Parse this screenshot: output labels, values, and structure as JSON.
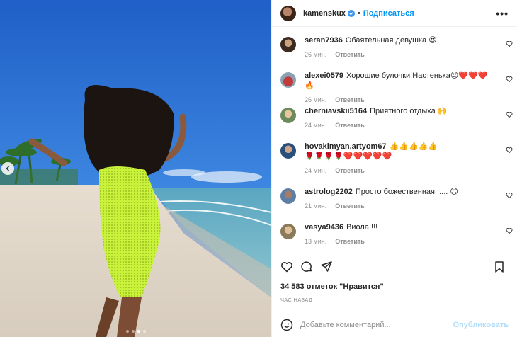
{
  "post": {
    "author": "kamenskux",
    "follow_label": "Подписаться",
    "separator": "•",
    "more_label": "•••"
  },
  "comments": [
    {
      "user": "seran7936",
      "text": "Обаятельная девушка 😍",
      "time": "26 мин.",
      "reply": "Ответить"
    },
    {
      "user": "alexei0579",
      "text": "Хорошие булочки Настенька😍❤️❤️❤️🔥",
      "time": "26 мин.",
      "reply": "Ответить"
    },
    {
      "user": "cherniavskii5164",
      "text": "Приятного отдыха 🙌",
      "time": "24 мин.",
      "reply": "Ответить"
    },
    {
      "user": "hovakimyan.artyom67",
      "text": "👍👍👍👍👍🌹🌹🌹🌹❤️❤️❤️❤️❤️",
      "time": "24 мин.",
      "reply": "Ответить"
    },
    {
      "user": "astrolog2202",
      "text": "Просто божественная...... 😍",
      "time": "21 мин.",
      "reply": "Ответить"
    },
    {
      "user": "vasya9436",
      "text": "Виола !!!",
      "time": "13 мин.",
      "reply": "Ответить"
    }
  ],
  "likes_text": "34 583 отметок \"Нравится\"",
  "time_ago": "ЧАС НАЗАД",
  "add_comment": {
    "placeholder": "Добавьте комментарий...",
    "publish_label": "Опубликовать"
  },
  "colors": {
    "accent": "#0095f6",
    "publish_disabled": "#b2dffc",
    "muted": "#8e8e8e"
  },
  "icons": [
    "heart-icon",
    "comment-icon",
    "share-icon",
    "bookmark-icon",
    "smile-icon",
    "verified-icon",
    "chevron-left-icon"
  ]
}
